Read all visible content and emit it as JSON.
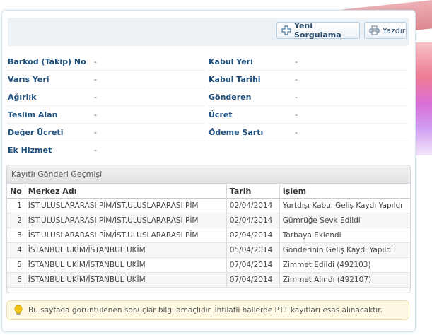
{
  "toolbar": {
    "new_query_label": "Yeni Sorgulama",
    "print_label": "Yazdır"
  },
  "info_left": [
    {
      "label": "Barkod (Takip) No",
      "value": "-"
    },
    {
      "label": "Varış Yeri",
      "value": "-"
    },
    {
      "label": "Ağırlık",
      "value": "-"
    },
    {
      "label": "Teslim Alan",
      "value": "-"
    },
    {
      "label": "Değer Ücreti",
      "value": "-"
    },
    {
      "label": "Ek Hizmet",
      "value": "-"
    }
  ],
  "info_right": [
    {
      "label": "Kabul Yeri",
      "value": "-"
    },
    {
      "label": "Kabul Tarihi",
      "value": "-"
    },
    {
      "label": "Gönderen",
      "value": "-"
    },
    {
      "label": "Ücret",
      "value": "-"
    },
    {
      "label": "Ödeme Şartı",
      "value": "-"
    }
  ],
  "history": {
    "title": "Kayıtlı Gönderi Geçmişi",
    "columns": [
      "No",
      "Merkez Adı",
      "Tarih",
      "İşlem"
    ],
    "rows": [
      {
        "no": "1",
        "center": "İST.ULUSLARARASI PİM/İST.ULUSLARARASI PİM",
        "date": "02/04/2014",
        "action": "Yurtdışı Kabul Geliş Kaydı Yapıldı"
      },
      {
        "no": "2",
        "center": "İST.ULUSLARARASI PİM/İST.ULUSLARARASI PİM",
        "date": "02/04/2014",
        "action": "Gümrüğe Sevk Edildi"
      },
      {
        "no": "3",
        "center": "İST.ULUSLARARASI PİM/İST.ULUSLARARASI PİM",
        "date": "02/04/2014",
        "action": "Torbaya Eklendi"
      },
      {
        "no": "4",
        "center": "İSTANBUL UKİM/İSTANBUL UKİM",
        "date": "05/04/2014",
        "action": "Gönderinin Geliş Kaydı Yapıldı"
      },
      {
        "no": "5",
        "center": "İSTANBUL UKİM/İSTANBUL UKİM",
        "date": "07/04/2014",
        "action": "Zimmet Edildi (492103)"
      },
      {
        "no": "6",
        "center": "İSTANBUL UKİM/İSTANBUL UKİM",
        "date": "07/04/2014",
        "action": "Zimmet Alındı (492107)"
      }
    ]
  },
  "note": {
    "text": "Bu sayfada görüntülenen sonuçlar bilgi amaçlıdır. İhtilafli hallerde PTT kayıtları esas alınacaktır."
  },
  "icons": {
    "new_query": "plus-icon",
    "print": "printer-icon",
    "note": "lightbulb-icon"
  },
  "colors": {
    "label": "#1f4f7c",
    "note_bg": "#fdf9e3"
  }
}
